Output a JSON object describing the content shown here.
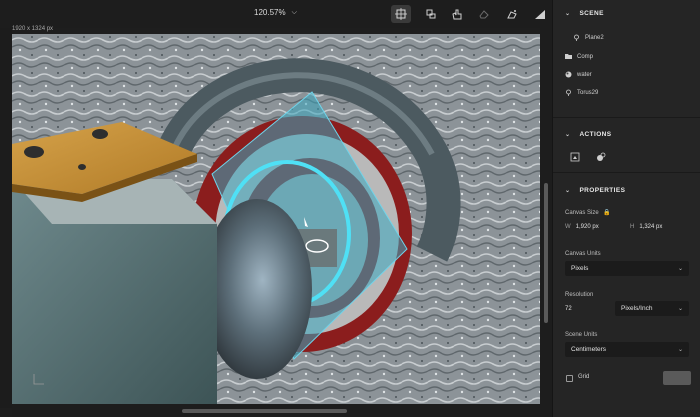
{
  "toolbar": {
    "zoom": "120.57%",
    "tools": [
      "artboard-icon",
      "transform-icon",
      "select-hand-icon",
      "eraser-icon",
      "magic-select-icon",
      "histogram-icon"
    ]
  },
  "canvas": {
    "size_label": "1920 x 1324 px"
  },
  "panel": {
    "scene": {
      "title": "SCENE",
      "items": [
        {
          "label": "Plane2",
          "icon": "light-icon"
        },
        {
          "label": "Comp",
          "icon": "folder-icon"
        },
        {
          "label": "water",
          "icon": "material-icon"
        },
        {
          "label": "Torus29",
          "icon": "light-icon"
        }
      ]
    },
    "actions": {
      "title": "ACTIONS"
    },
    "properties": {
      "title": "PROPERTIES",
      "canvas_size_label": "Canvas Size",
      "width_key": "W",
      "width_value": "1,920 px",
      "height_key": "H",
      "height_value": "1,324 px",
      "canvas_units_label": "Canvas Units",
      "canvas_units_value": "Pixels",
      "resolution_label": "Resolution",
      "resolution_value": "72",
      "resolution_unit": "Pixels/Inch",
      "scene_units_label": "Scene Units",
      "scene_units_value": "Centimeters",
      "grid_label": "Grid"
    }
  }
}
